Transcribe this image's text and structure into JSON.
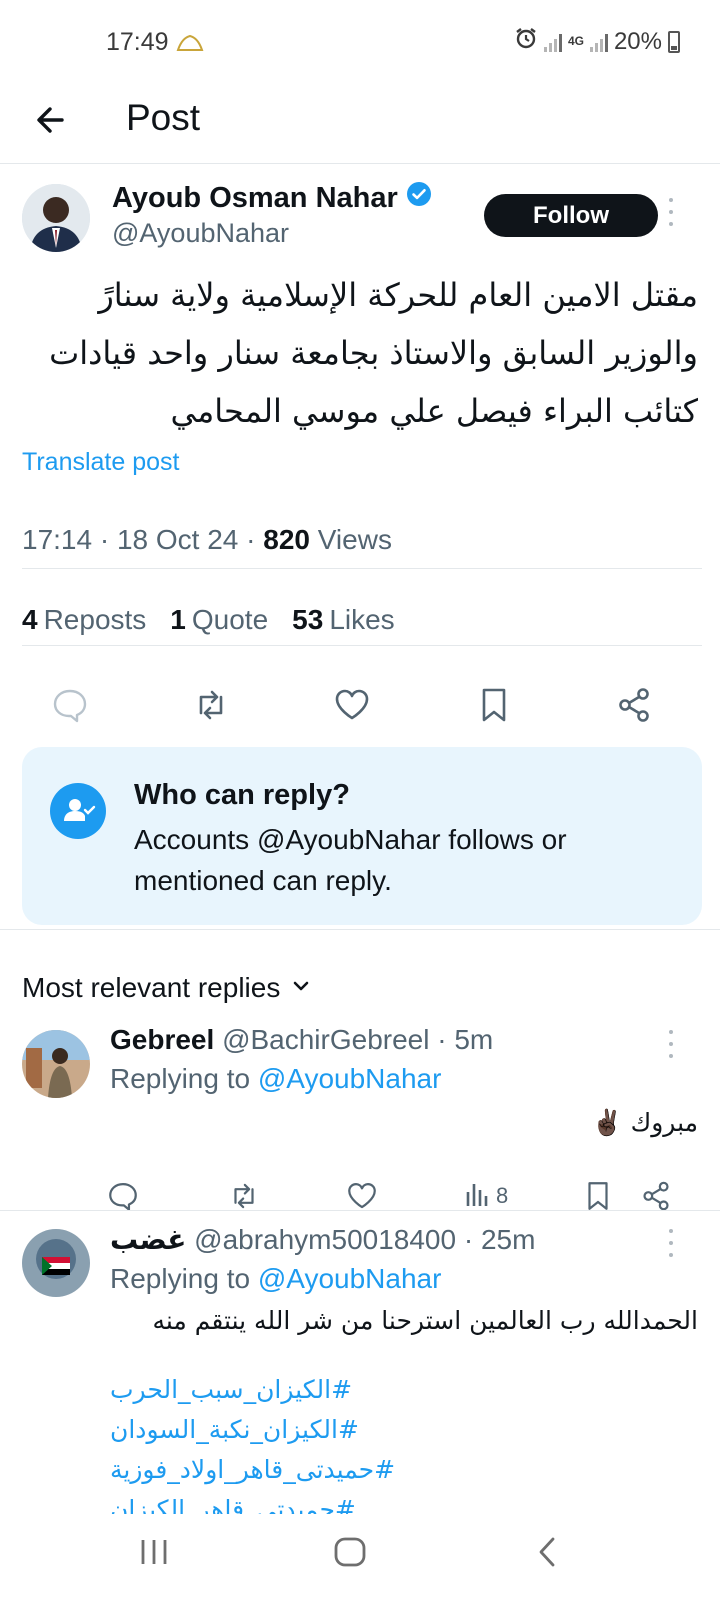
{
  "status_bar": {
    "time": "17:49",
    "network": "4G",
    "battery": "20%"
  },
  "header": {
    "title": "Post"
  },
  "post": {
    "author_name": "Ayoub Osman Nahar",
    "author_handle": "@AyoubNahar",
    "follow_label": "Follow",
    "text_lines": [
      "مقتل الامين العام للحركة الإسلامية ولاية سنارً",
      "والوزير السابق والاستاذ بجامعة سنار واحد قيادات",
      "كتائب البراء فيصل علي موسي المحامي"
    ],
    "translate_label": "Translate post",
    "time": "17:14",
    "date": "18 Oct 24",
    "views_count": "820",
    "views_label": "Views",
    "reposts_count": "4",
    "reposts_label": "Reposts",
    "quotes_count": "1",
    "quotes_label": "Quote",
    "likes_count": "53",
    "likes_label": "Likes"
  },
  "who_can_reply": {
    "title": "Who can reply?",
    "body": "Accounts @AyoubNahar follows or mentioned can reply."
  },
  "replies_sort": {
    "label": "Most relevant replies"
  },
  "replies": [
    {
      "name": "Gebreel",
      "handle": "@BachirGebreel",
      "age": "5m",
      "replying_prefix": "Replying to",
      "replying_to": "@AyoubNahar",
      "text": "مبروك ✌🏿",
      "views": "8"
    },
    {
      "name": "غضب",
      "handle": "@abrahym50018400",
      "age": "25m",
      "replying_prefix": "Replying to",
      "replying_to": "@AyoubNahar",
      "text": "الحمدالله رب العالمين استرحنا من شر الله ينتقم منه",
      "hashtags": [
        "#الكيزان_سبب_الحرب",
        "#الكيزان_نكبة_السودان",
        "#حميدتى_قاهر_اولاد_فوزية",
        "#حميدتى_قاهر_الكيزان"
      ]
    }
  ],
  "colors": {
    "accent": "#1d9bf0",
    "text": "#0f1419",
    "muted": "#536471",
    "card_bg": "#e8f5fd",
    "follow_bg": "#0f1419"
  }
}
